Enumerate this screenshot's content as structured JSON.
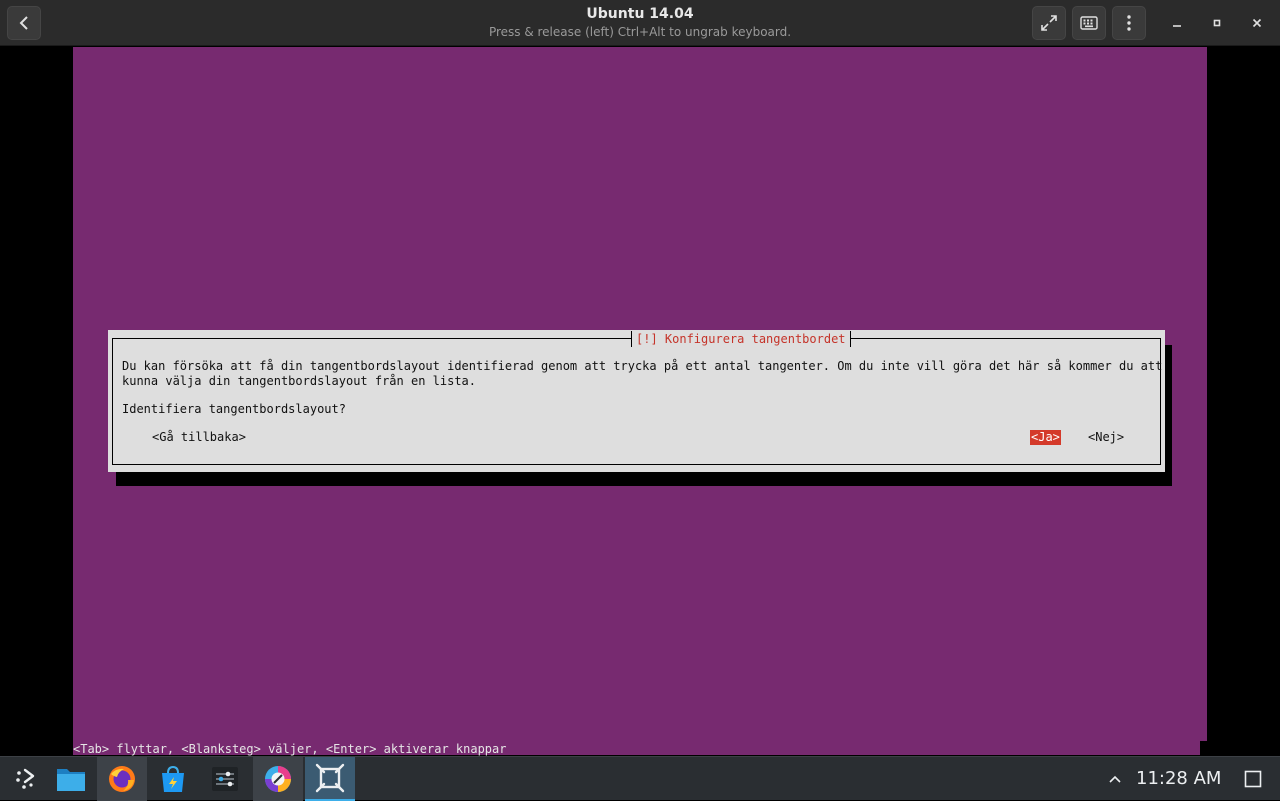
{
  "window": {
    "title": "Ubuntu 14.04",
    "subtitle": "Press & release (left) Ctrl+Alt to ungrab keyboard."
  },
  "installer": {
    "background_color": "#772a70",
    "dialog_title": "[!] Konfigurera tangentbordet",
    "body_line1": "Du kan försöka att få din tangentbordslayout identifierad genom att trycka på ett antal tangenter. Om du inte vill göra det här så kommer du att",
    "body_line2": "kunna välja din tangentbordslayout från en lista.",
    "question": "Identifiera tangentbordslayout?",
    "back_button": "<Gå tillbaka>",
    "yes_button": "<Ja>",
    "no_button": "<Nej>",
    "hint": "<Tab> flyttar, <Blanksteg> väljer, <Enter> aktiverar knappar"
  },
  "taskbar": {
    "apps": [
      {
        "name": "application-launcher-icon"
      },
      {
        "name": "file-manager-icon"
      },
      {
        "name": "firefox-icon"
      },
      {
        "name": "software-store-icon"
      },
      {
        "name": "settings-icon"
      },
      {
        "name": "krita-icon"
      },
      {
        "name": "virtual-machine-icon"
      }
    ],
    "clock": "11:28 AM"
  },
  "colors": {
    "selected_button": "#d43a2a",
    "dialog_title": "#c5342a",
    "accent": "#3daee9"
  }
}
